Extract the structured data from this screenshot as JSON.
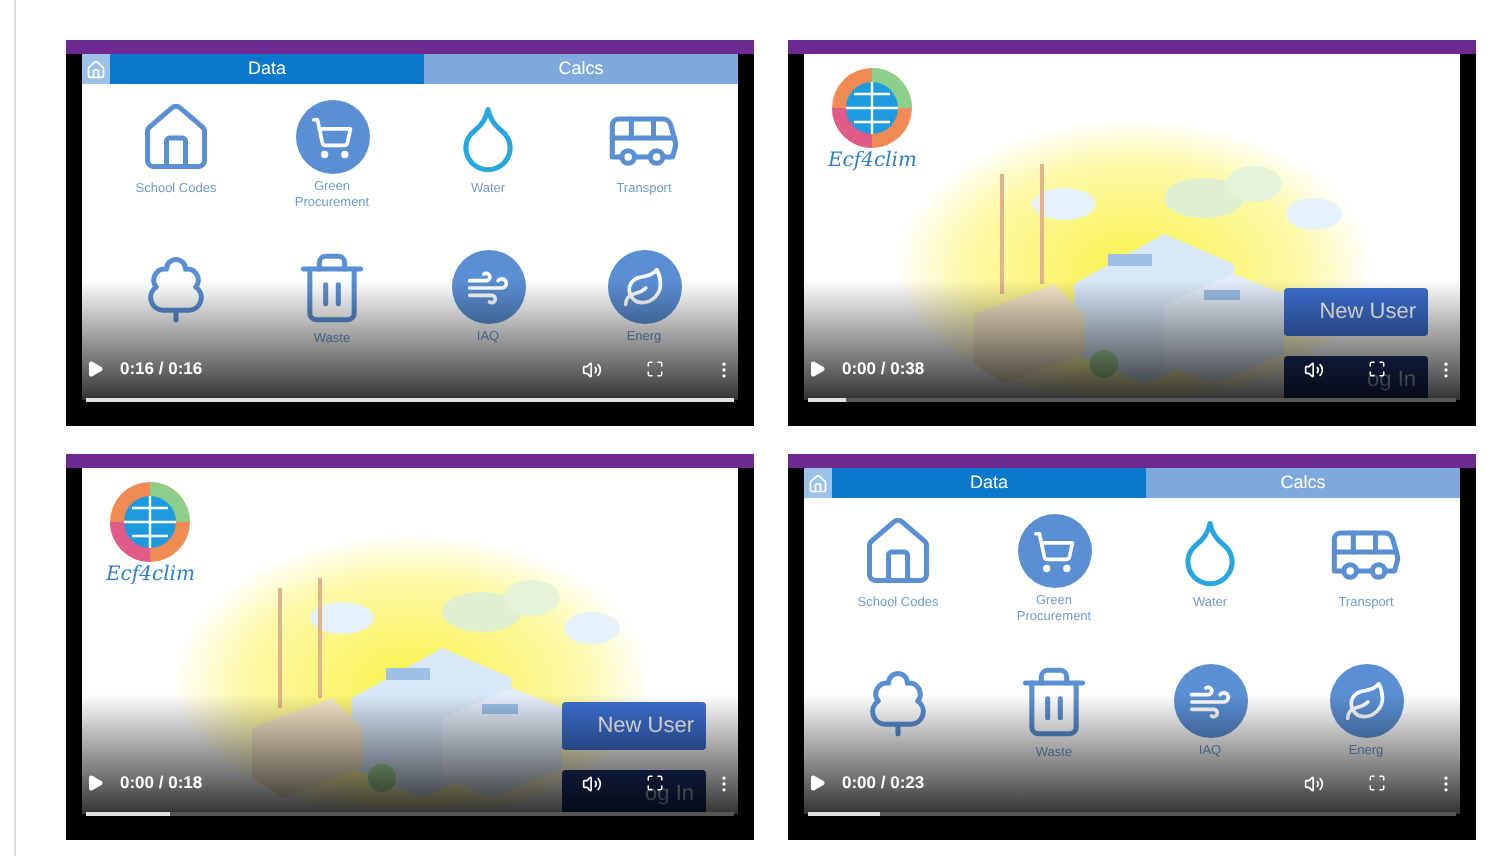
{
  "videos": [
    {
      "screen": {
        "kind": "menu",
        "tabs": [
          {
            "label": "Data",
            "selected": true
          },
          {
            "label": "Calcs",
            "selected": false
          }
        ],
        "tiles": [
          {
            "kind": "labeled",
            "label": "School Codes"
          },
          {
            "kind": "labeled",
            "label": "Green Procurement"
          },
          {
            "kind": "labeled",
            "label": "Water"
          },
          {
            "kind": "labeled",
            "label": "Transport"
          },
          {
            "kind": "unlabeled"
          },
          {
            "kind": "labeled",
            "label": "Waste"
          },
          {
            "kind": "labeled",
            "label": "IAQ"
          },
          {
            "kind": "labeled",
            "label": "Energ"
          }
        ]
      },
      "time": "0:16 / 0:16",
      "level": 1.0
    },
    {
      "screen": {
        "kind": "login",
        "logo": "Ecf4clim",
        "buttons": [
          "New User",
          "og In"
        ]
      },
      "time": "0:00 / 0:38",
      "level": 0.06
    },
    {
      "screen": {
        "kind": "login",
        "logo": "Ecf4clim",
        "buttons": [
          "New User",
          "og In"
        ]
      },
      "time": "0:00 / 0:18",
      "level": 0.13
    },
    {
      "screen": {
        "kind": "menu",
        "tabs": [
          {
            "label": "Data",
            "selected": true
          },
          {
            "label": "Calcs",
            "selected": false
          }
        ],
        "tiles": [
          {
            "kind": "labeled",
            "label": "School Codes"
          },
          {
            "kind": "labeled",
            "label": "Green Procurement"
          },
          {
            "kind": "labeled",
            "label": "Water"
          },
          {
            "kind": "labeled",
            "label": "Transport"
          },
          {
            "kind": "unlabeled"
          },
          {
            "kind": "labeled",
            "label": "Waste"
          },
          {
            "kind": "labeled",
            "label": "IAQ"
          },
          {
            "kind": "labeled",
            "label": "Energ"
          }
        ]
      },
      "time": "0:00 / 0:23",
      "level": 0.11
    }
  ]
}
